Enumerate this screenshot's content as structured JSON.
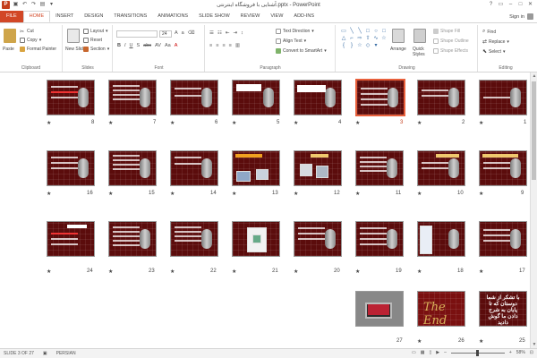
{
  "app": {
    "title": "آشنایی با فروشگاه اینترنتی.pptx - PowerPoint",
    "signin": "Sign in"
  },
  "tabs": [
    "FILE",
    "HOME",
    "INSERT",
    "DESIGN",
    "TRANSITIONS",
    "ANIMATIONS",
    "SLIDE SHOW",
    "REVIEW",
    "VIEW",
    "ADD-INS"
  ],
  "active_tab": "HOME",
  "ribbon": {
    "clipboard": {
      "label": "Clipboard",
      "paste": "Paste",
      "cut": "Cut",
      "copy": "Copy",
      "format_painter": "Format Painter"
    },
    "slides": {
      "label": "Slides",
      "new_slide": "New Slide",
      "layout": "Layout",
      "reset": "Reset",
      "section": "Section"
    },
    "font": {
      "label": "Font",
      "font_name": "",
      "font_size": "24"
    },
    "paragraph": {
      "label": "Paragraph",
      "text_direction": "Text Direction",
      "align_text": "Align Text",
      "convert_smartart": "Convert to SmartArt"
    },
    "drawing": {
      "label": "Drawing",
      "arrange": "Arrange",
      "quick_styles": "Quick Styles",
      "shape_fill": "Shape Fill",
      "shape_outline": "Shape Outline",
      "shape_effects": "Shape Effects"
    },
    "editing": {
      "label": "Editing",
      "find": "Find",
      "replace": "Replace",
      "select": "Select"
    }
  },
  "slides": {
    "row1": [
      "8",
      "7",
      "6",
      "5",
      "4",
      "3",
      "2",
      "1"
    ],
    "row2": [
      "16",
      "15",
      "14",
      "13",
      "12",
      "11",
      "10",
      "9"
    ],
    "row3": [
      "24",
      "23",
      "22",
      "21",
      "20",
      "19",
      "18",
      "17"
    ],
    "row4": [
      "27",
      "26",
      "25"
    ],
    "selected": "3",
    "star": "★",
    "slide26_text": "The End",
    "slide25_text": "با تشکر از شما دوستان که تا پایان به شرح دادن ما گوش دادید"
  },
  "status": {
    "slide_info": "SLIDE 3 OF 27",
    "language": "PERSIAN",
    "zoom": "58%"
  },
  "colors": {
    "accent": "#d24726",
    "slide_bg": "#5b0c0c",
    "selected_border": "#e8603c"
  }
}
